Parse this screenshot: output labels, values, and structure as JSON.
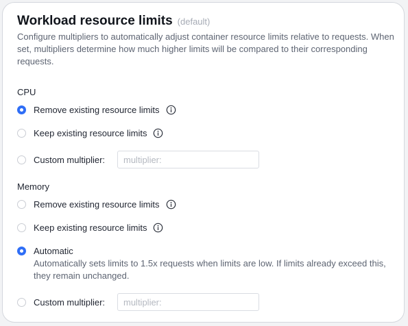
{
  "header": {
    "title": "Workload resource limits",
    "badge": "(default)",
    "description": "Configure multipliers to automatically adjust container resource limits relative to requests. When set, multipliers determine how much higher limits will be compared to their corresponding requests."
  },
  "cpu": {
    "label": "CPU",
    "options": [
      {
        "label": "Remove existing resource limits",
        "selected": true,
        "has_info": true
      },
      {
        "label": "Keep existing resource limits",
        "selected": false,
        "has_info": true
      },
      {
        "label": "Custom multiplier:",
        "selected": false,
        "input_placeholder": "multiplier:",
        "input_value": ""
      }
    ]
  },
  "memory": {
    "label": "Memory",
    "options": [
      {
        "label": "Remove existing resource limits",
        "selected": false,
        "has_info": true
      },
      {
        "label": "Keep existing resource limits",
        "selected": false,
        "has_info": true
      },
      {
        "label": "Automatic",
        "selected": true,
        "description": "Automatically sets limits to 1.5x requests when limits are low. If limits already exceed this, they remain unchanged."
      },
      {
        "label": "Custom multiplier:",
        "selected": false,
        "input_placeholder": "multiplier:",
        "input_value": ""
      }
    ]
  },
  "icons": {
    "info": "info-circle-icon"
  },
  "colors": {
    "accent": "#2f6ef6",
    "text": "#1f2430",
    "muted": "#5d6472",
    "border": "#d4d7dd"
  }
}
